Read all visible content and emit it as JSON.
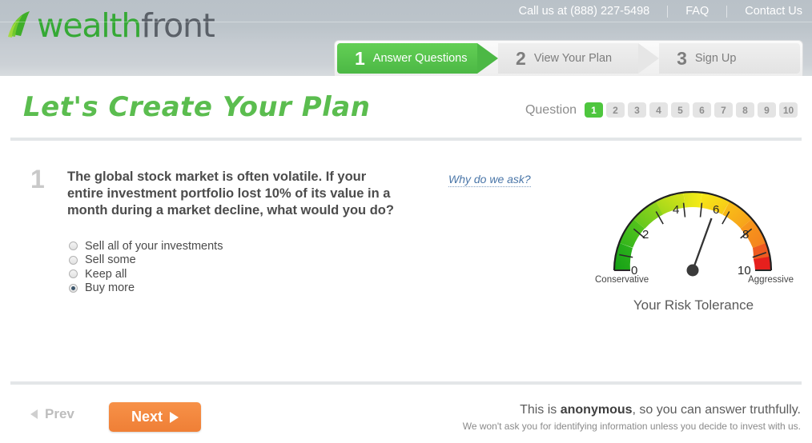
{
  "header": {
    "logo": {
      "part1": "wealth",
      "part2": "front",
      "mark": "leaf-icon"
    },
    "phone": "Call us at (888) 227-5498",
    "faq": "FAQ",
    "contact": "Contact Us"
  },
  "steps": [
    {
      "num": "1",
      "label": "Answer Questions",
      "active": true
    },
    {
      "num": "2",
      "label": "View Your Plan",
      "active": false
    },
    {
      "num": "3",
      "label": "Sign Up",
      "active": false
    }
  ],
  "page_title": "Let's Create Your Plan",
  "question_nav": {
    "label": "Question",
    "items": [
      "1",
      "2",
      "3",
      "4",
      "5",
      "6",
      "7",
      "8",
      "9",
      "10"
    ],
    "active": "1"
  },
  "question": {
    "number": "1",
    "text": "The global stock market is often volatile. If your entire investment portfolio lost 10% of its value in a month during a market decline, what would you do?",
    "why_link": "Why do we ask?",
    "answers": [
      {
        "label": "Sell all of your investments",
        "selected": false
      },
      {
        "label": "Sell some",
        "selected": false
      },
      {
        "label": "Keep all",
        "selected": false
      },
      {
        "label": "Buy more",
        "selected": true
      }
    ]
  },
  "gauge": {
    "caption": "Your Risk Tolerance",
    "left_label": "Conservative",
    "right_label": "Aggressive",
    "tick_labels": [
      "0",
      "2",
      "4",
      "6",
      "8",
      "10"
    ],
    "min": 0,
    "max": 10,
    "value": 6,
    "colors": [
      "#1ea31e",
      "#4cc11e",
      "#8fd21c",
      "#d7e21a",
      "#f2e71b",
      "#f6c11b",
      "#f59b1d",
      "#f2761f",
      "#ee4b23",
      "#e8231f"
    ]
  },
  "footer": {
    "prev": "Prev",
    "next": "Next",
    "note_pre": "This is ",
    "note_bold": "anonymous",
    "note_post": ", so you can answer truthfully.",
    "note_small": "We won't ask you for identifying information unless you decide to invest with us."
  }
}
